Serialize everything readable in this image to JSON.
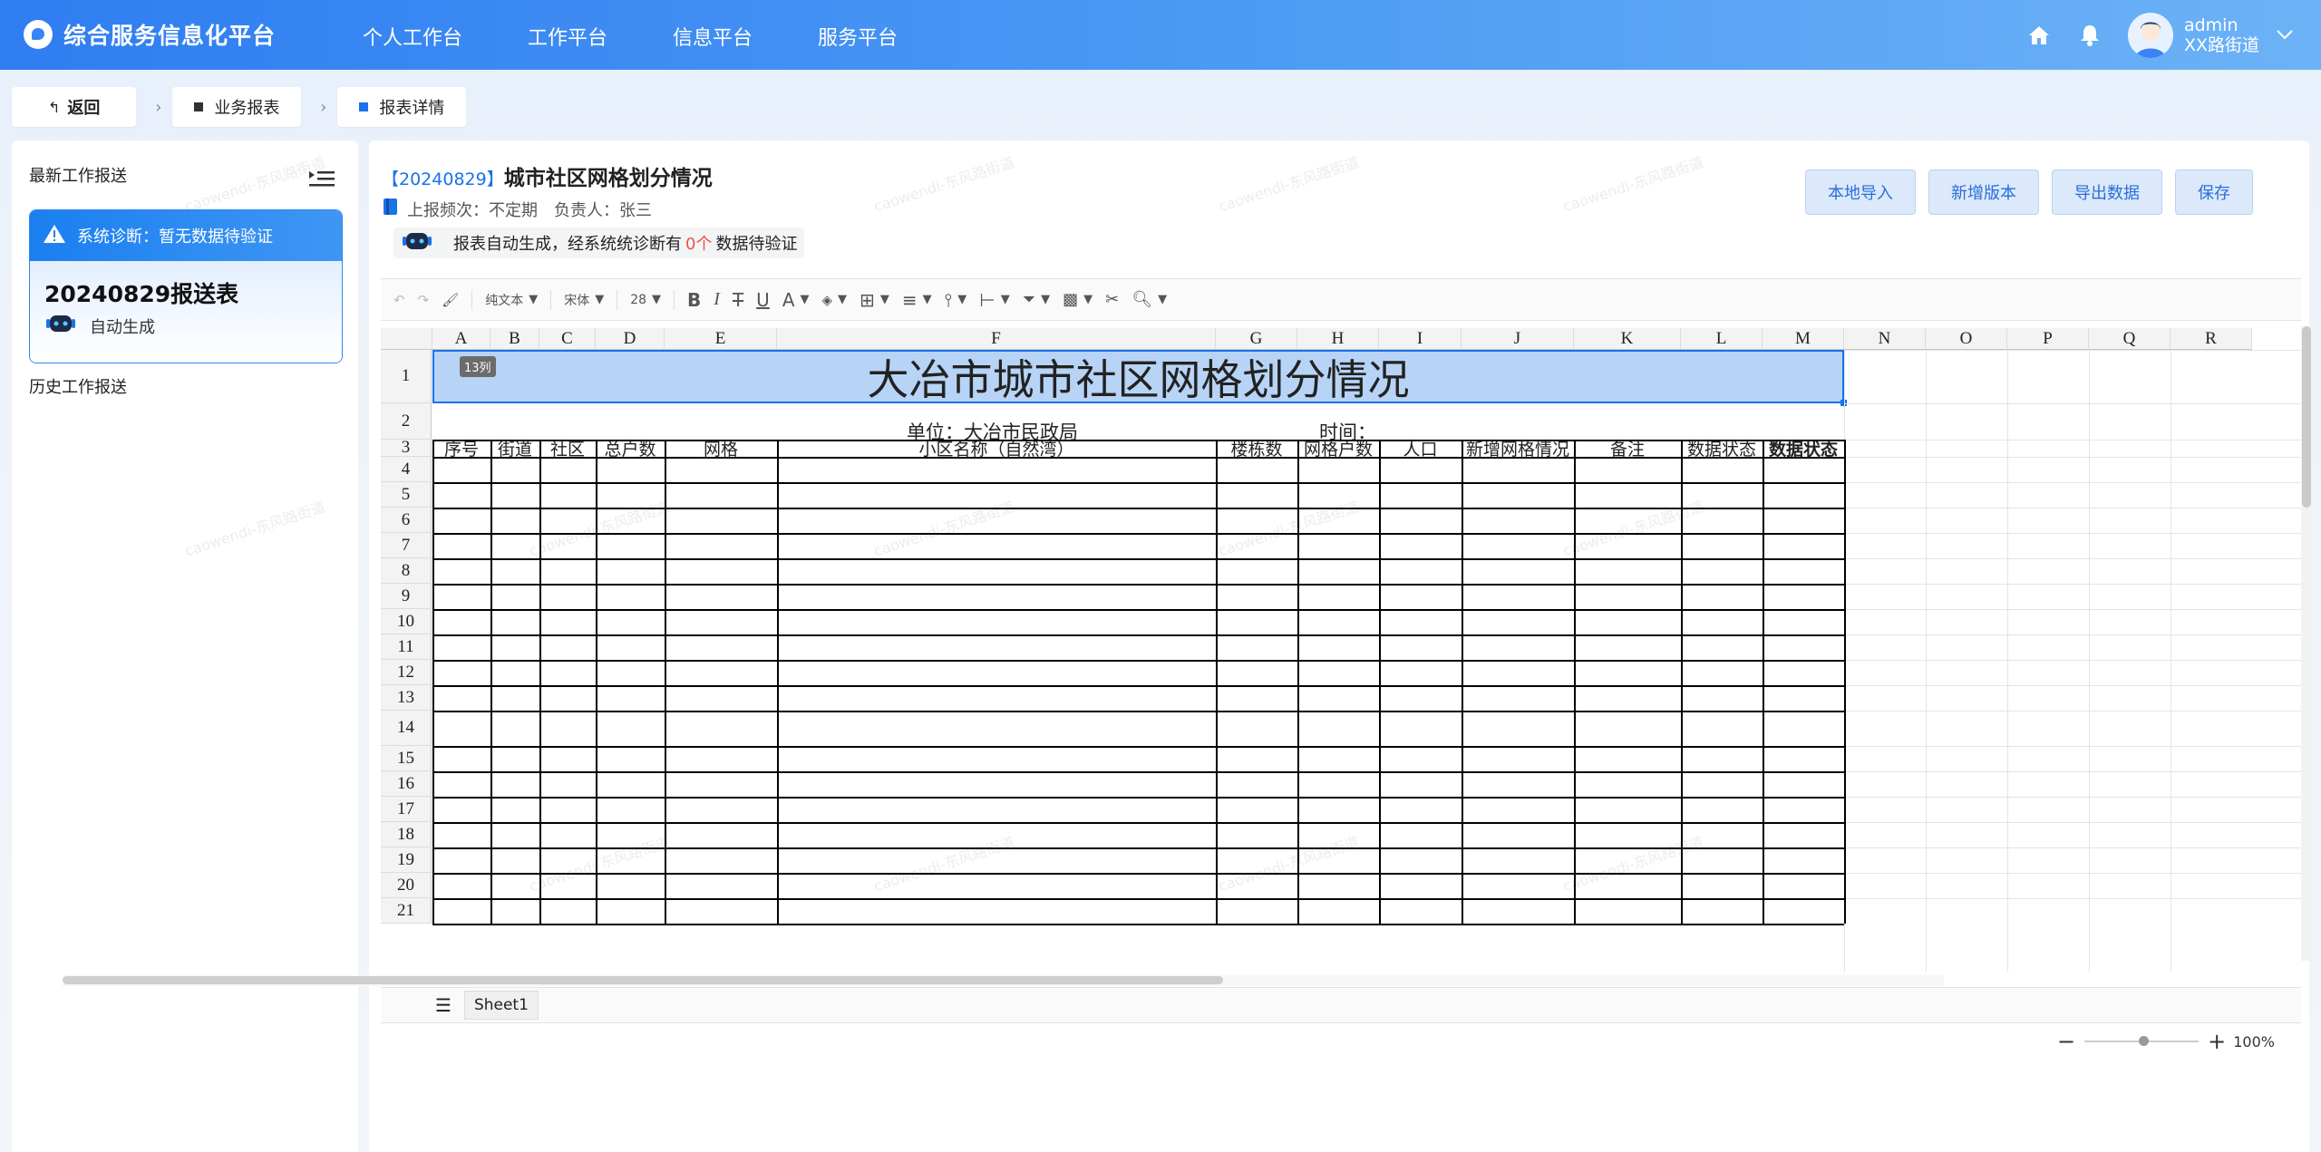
{
  "app": {
    "title": "综合服务信息化平台"
  },
  "nav": [
    {
      "label": "个人工作台"
    },
    {
      "label": "工作平台"
    },
    {
      "label": "信息平台"
    },
    {
      "label": "服务平台"
    }
  ],
  "user": {
    "name": "admin",
    "org": "XX路街道"
  },
  "breadcrumb": {
    "back": "返回",
    "items": [
      {
        "label": "业务报表"
      },
      {
        "label": "报表详情"
      }
    ]
  },
  "left": {
    "latest_heading": "最新工作报送",
    "diag_text": "系统诊断：暂无数据待验证",
    "card_title": "20240829报送表",
    "card_sub": "自动生成",
    "history_heading": "历史工作报送"
  },
  "report": {
    "date_tag": "【20240829】",
    "title": "城市社区网格划分情况",
    "freq_label": "上报频次：",
    "freq_value": "不定期",
    "owner_label": "负责人：",
    "owner_value": "张三",
    "note_prefix": "报表自动生成，经系统统诊断有",
    "note_count": "0个",
    "note_suffix": "数据待验证"
  },
  "actions": [
    {
      "label": "本地导入"
    },
    {
      "label": "新增版本"
    },
    {
      "label": "导出数据"
    },
    {
      "label": "保存"
    }
  ],
  "toolbar": {
    "format": "纯文本",
    "font": "宋体",
    "size": "28"
  },
  "sheet": {
    "columns": [
      "A",
      "B",
      "C",
      "D",
      "E",
      "F",
      "G",
      "H",
      "I",
      "J",
      "K",
      "L",
      "M",
      "N",
      "O",
      "P",
      "Q",
      "R"
    ],
    "rows": [
      "1",
      "2",
      "3",
      "4",
      "5",
      "6",
      "7",
      "8",
      "9",
      "10",
      "11",
      "12",
      "13",
      "14",
      "15",
      "16",
      "17",
      "18",
      "19",
      "20",
      "21"
    ],
    "title": "大冶市城市社区网格划分情况",
    "merge_badge": "13列",
    "unit": "单位：大冶市民政局",
    "time": "时间：",
    "headers": [
      "序号",
      "街道",
      "社区",
      "总户数",
      "网格",
      "小区名称（自然湾）",
      "楼栋数",
      "网格户数",
      "人口",
      "新增网格情况",
      "备注",
      "数据状态",
      "数据状态"
    ],
    "tab": "Sheet1",
    "zoom": "100%"
  },
  "watermark": "caowendi-东风路街道"
}
